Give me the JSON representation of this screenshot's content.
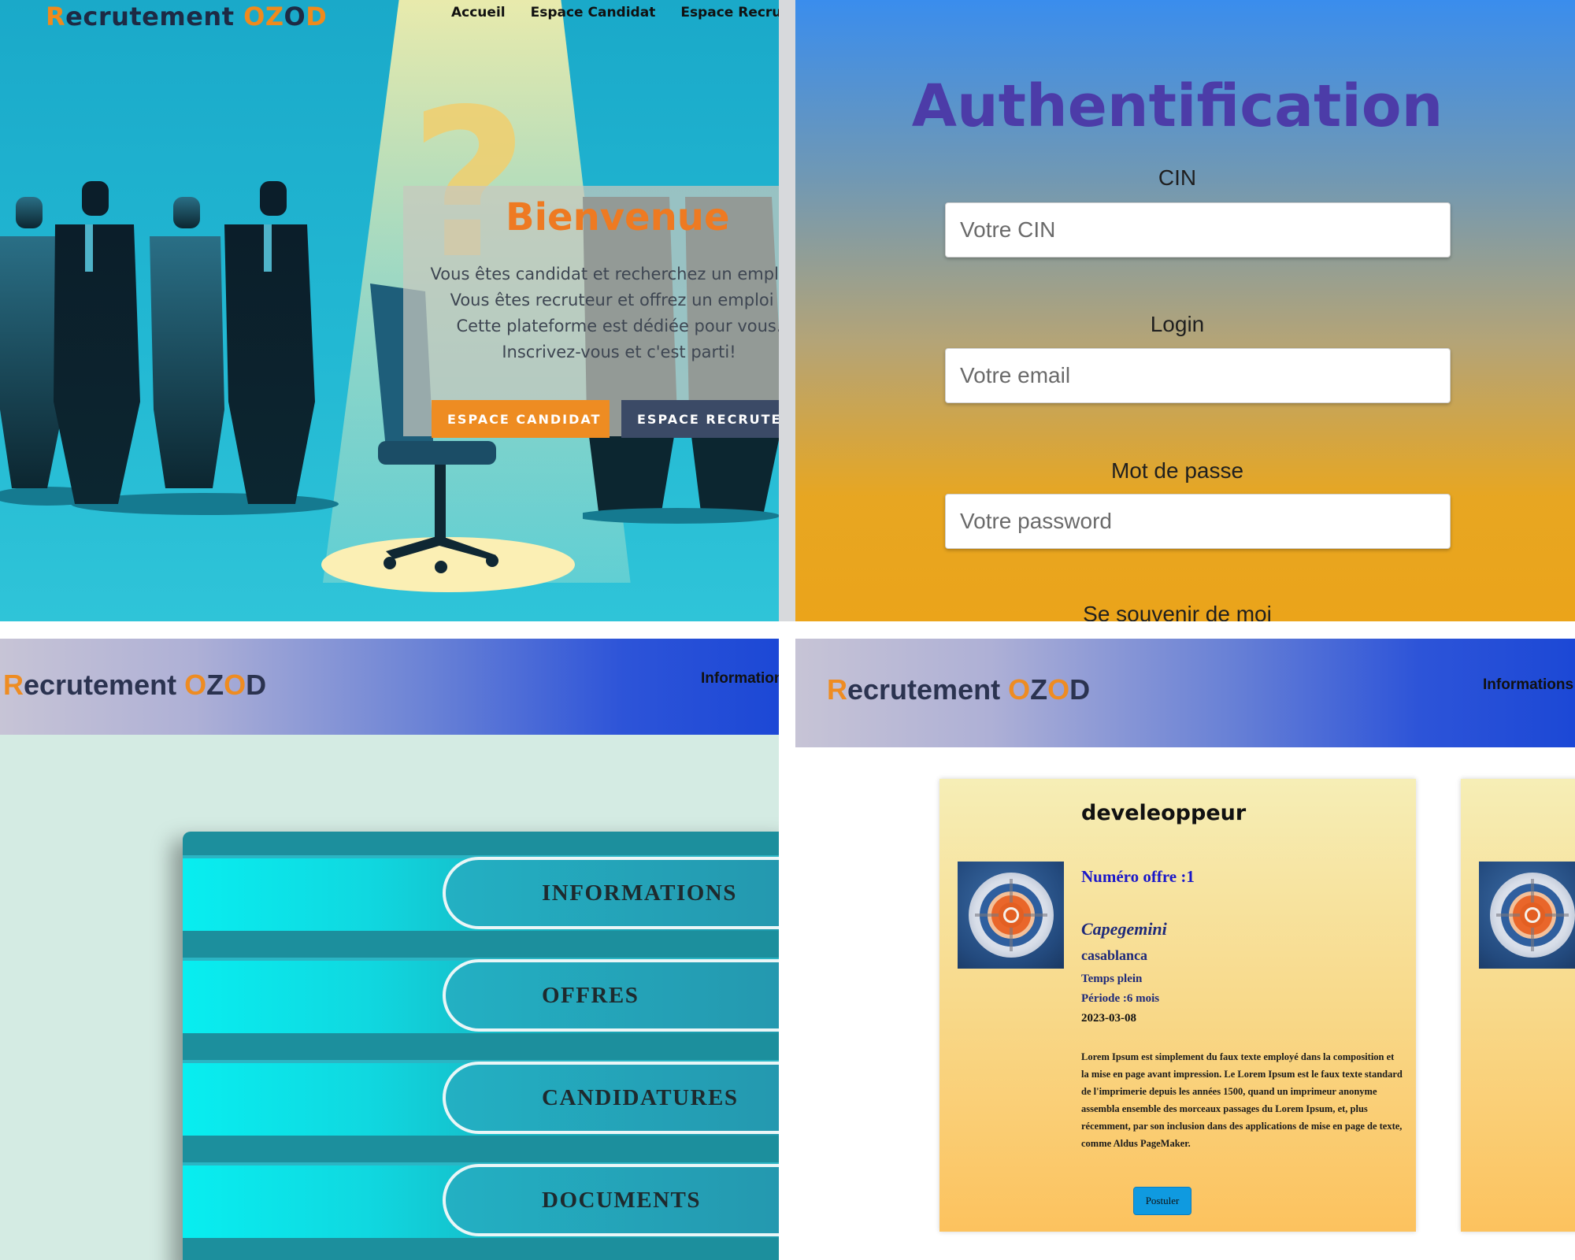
{
  "welcome": {
    "brand": {
      "first_letter": "R",
      "rest": "ecrutement ",
      "o1": "O",
      "z": "Z",
      "o2": "O",
      "d": "D"
    },
    "nav": [
      "Accueil",
      "Espace Candidat",
      "Espace Recruteur"
    ],
    "title": "Bienvenue",
    "lines": [
      "Vous êtes candidat et recherchez un emploi ?",
      "Vous êtes recruteur et offrez un emploi ?",
      "Cette plateforme est dédiée pour vous.",
      "Inscrivez-vous et c'est parti!"
    ],
    "btn_candidat": "ESPACE CANDIDAT",
    "btn_recruteur": "ESPACE RECRUTEUR",
    "question_mark": "?"
  },
  "login": {
    "title": "Authentification",
    "cin_label": "CIN",
    "cin_placeholder": "Votre CIN",
    "login_label": "Login",
    "login_placeholder": "Votre email",
    "password_label": "Mot de passe",
    "password_placeholder": "Votre password",
    "remember": "Se souvenir de moi"
  },
  "menu": {
    "brand": {
      "first_letter": "R",
      "rest": "ecrutement ",
      "o1": "O",
      "z": "Z",
      "o2": "O",
      "d": "D"
    },
    "nav": "Informations",
    "items": [
      "INFORMATIONS",
      "OFFRES",
      "CANDIDATURES",
      "DOCUMENTS"
    ]
  },
  "offers": {
    "brand": {
      "first_letter": "R",
      "rest": "ecrutement ",
      "o1": "O",
      "z": "Z",
      "o2": "O",
      "d": "D"
    },
    "nav": "Informations",
    "offer": {
      "title": "develeoppeur",
      "numero": "Numéro offre :1",
      "company": "Capegemini",
      "city": "casablanca",
      "contract": "Temps plein",
      "periode": "Période :6 mois",
      "date": "2023-03-08",
      "description": "Lorem Ipsum est simplement du faux texte employé dans la composition et la mise en page avant impression. Le Lorem Ipsum est le faux texte standard de l'imprimerie depuis les années 1500, quand un imprimeur anonyme assembla ensemble des morceaux passages du Lorem Ipsum, et, plus récemment, par son inclusion dans des applications de mise en page de texte, comme Aldus PageMaker.",
      "apply": "Postuler"
    }
  },
  "colors": {
    "accent_orange": "#ee8c22",
    "title_purple": "#4c3ca8",
    "header_blue": "#1c48d6",
    "apply_blue": "#0f9ae0"
  }
}
